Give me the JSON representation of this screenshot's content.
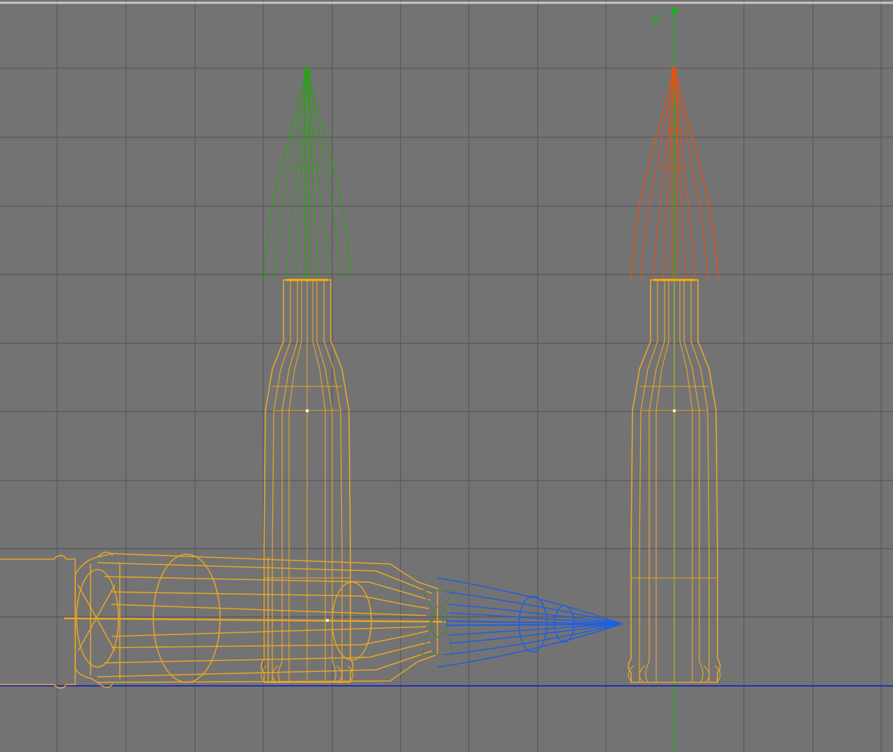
{
  "viewport": {
    "axis_label": "Y",
    "colors": {
      "background": "#747374",
      "grid": "#5c5b5c",
      "top_border": "#c8c8c8",
      "ground_line": "#1e2fb4",
      "y_axis": "#1fae1f",
      "bullet_casing": "#e8a824",
      "tip_green": "#2f9f1a",
      "tip_orange": "#e0521a",
      "tip_blue": "#1f5fe0",
      "pivot_dot": "#f2f2f2"
    },
    "objects": [
      {
        "id": "bullet-left",
        "tip_color": "tip_green",
        "orientation": "vertical"
      },
      {
        "id": "bullet-right",
        "tip_color": "tip_orange",
        "orientation": "vertical",
        "selected": true
      },
      {
        "id": "bullet-lying",
        "tip_color": "tip_blue",
        "orientation": "horizontal"
      }
    ]
  }
}
